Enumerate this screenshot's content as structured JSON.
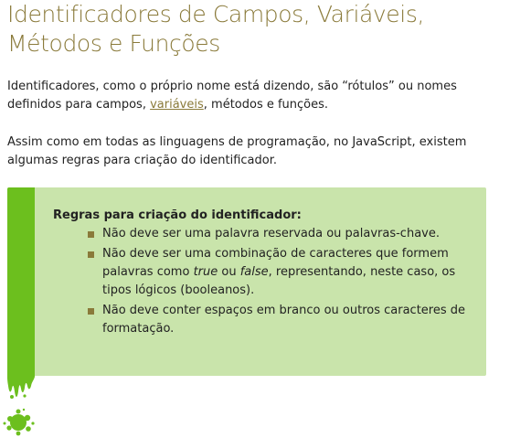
{
  "title_lines": [
    "Identificadores de Campos, Variáveis,",
    "Métodos e Funções"
  ],
  "paragraph1": {
    "line1": "Identificadores, como o próprio nome está dizendo, são “rótulos” ou nomes",
    "line2_before": "definidos para campos, ",
    "line2_link": "variáveis",
    "line2_after": ", métodos e funções."
  },
  "paragraph2": {
    "line1": "Assim como em todas as linguagens de programação, no JavaScript, existem",
    "line2": "algumas regras para criação do identificador."
  },
  "callout": {
    "heading": "Regras para criação do identificador:",
    "rule1": "Não deve ser uma palavra reservada ou palavras-chave.",
    "rule2": {
      "line1": "Não deve ser uma combinação de caracteres que formem",
      "line2_part1": "palavras como ",
      "line2_em1": "true",
      "line2_part2": " ou ",
      "line2_em2": "false",
      "line2_part3": ", representando, neste caso, os",
      "line3": "tipos lógicos (booleanos)."
    },
    "rule3": {
      "line1": "Não deve conter espaços em branco ou outros caracteres de",
      "line2": "formatação."
    }
  },
  "colors": {
    "title": "#8a7a3a",
    "link": "#8a7a3a",
    "callout_background": "#c9e4ab",
    "callout_bar": "#6cbf1e",
    "bullet": "#8a7a3a"
  }
}
